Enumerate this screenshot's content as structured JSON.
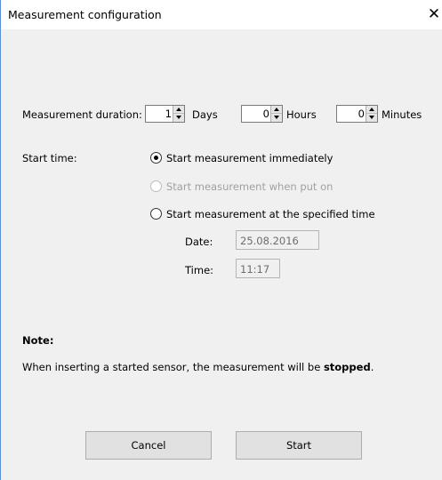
{
  "window": {
    "title": "Measurement configuration",
    "close_label": "✕"
  },
  "duration": {
    "label": "Measurement duration:",
    "days": {
      "value": "1",
      "unit": "Days"
    },
    "hours": {
      "value": "0",
      "unit": "Hours"
    },
    "minutes": {
      "value": "0",
      "unit": "Minutes"
    }
  },
  "start_time": {
    "label": "Start time:",
    "options": [
      {
        "label": "Start measurement immediately",
        "checked": true,
        "enabled": true
      },
      {
        "label": "Start measurement when put on",
        "checked": false,
        "enabled": false
      },
      {
        "label": "Start measurement at the specified time",
        "checked": false,
        "enabled": true
      }
    ],
    "date_label": "Date:",
    "date_value": "25.08.2016",
    "time_label": "Time:",
    "time_value": "11:17"
  },
  "note": {
    "heading": "Note:",
    "text_before": "When inserting a started sensor, the measurement will be ",
    "text_bold": "stopped",
    "text_after": "."
  },
  "buttons": {
    "cancel": "Cancel",
    "start": "Start"
  }
}
